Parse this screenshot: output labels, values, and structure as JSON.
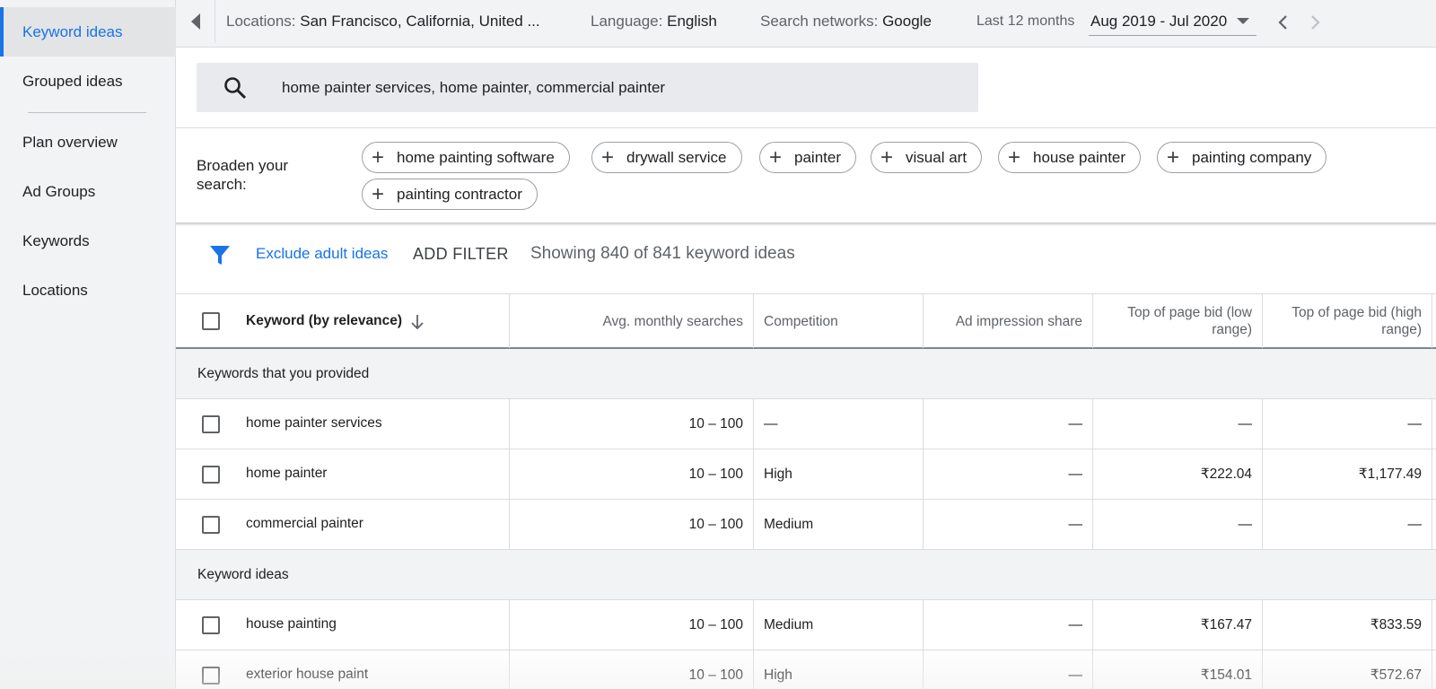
{
  "sidebar": {
    "items": [
      {
        "label": "Keyword ideas",
        "active": true
      },
      {
        "label": "Grouped ideas",
        "active": false
      },
      {
        "label": "Plan overview",
        "active": false
      },
      {
        "label": "Ad Groups",
        "active": false
      },
      {
        "label": "Keywords",
        "active": false
      },
      {
        "label": "Locations",
        "active": false
      }
    ]
  },
  "topbar": {
    "locations_key": "Locations:",
    "locations_val": "San Francisco, California, United ...",
    "language_key": "Language:",
    "language_val": "English",
    "networks_key": "Search networks:",
    "networks_val": "Google",
    "period_key": "Last 12 months",
    "period_val": "Aug 2019 - Jul 2020"
  },
  "search": {
    "query": "home painter services, home painter, commercial painter",
    "icon": "search-icon"
  },
  "broaden": {
    "label": "Broaden your search:",
    "chips": [
      "home painting software",
      "drywall service",
      "painter",
      "visual art",
      "house painter",
      "painting company",
      "painting contractor"
    ]
  },
  "filter": {
    "icon": "filter-icon",
    "exclude_adult": "Exclude adult ideas",
    "add_filter": "ADD FILTER",
    "showing": "Showing 840 of 841 keyword ideas"
  },
  "table": {
    "columns": [
      "Keyword (by relevance)",
      "Avg. monthly searches",
      "Competition",
      "Ad impression share",
      "Top of page bid (low range)",
      "Top of page bid (high range)"
    ],
    "groups": [
      {
        "title": "Keywords that you provided",
        "rows": [
          {
            "keyword": "home painter services",
            "searches": "10 – 100",
            "competition": "—",
            "share": "—",
            "low": "—",
            "high": "—"
          },
          {
            "keyword": "home painter",
            "searches": "10 – 100",
            "competition": "High",
            "share": "—",
            "low": "₹222.04",
            "high": "₹1,177.49"
          },
          {
            "keyword": "commercial painter",
            "searches": "10 – 100",
            "competition": "Medium",
            "share": "—",
            "low": "—",
            "high": "—"
          }
        ]
      },
      {
        "title": "Keyword ideas",
        "rows": [
          {
            "keyword": "house painting",
            "searches": "10 – 100",
            "competition": "Medium",
            "share": "—",
            "low": "₹167.47",
            "high": "₹833.59"
          },
          {
            "keyword": "exterior house paint",
            "searches": "10 – 100",
            "competition": "High",
            "share": "—",
            "low": "₹154.01",
            "high": "₹572.67"
          }
        ]
      }
    ]
  },
  "colors": {
    "accent": "#1a73e8",
    "sidebar_bg": "#f1f3f4",
    "group_bg": "#f1f3f4"
  }
}
